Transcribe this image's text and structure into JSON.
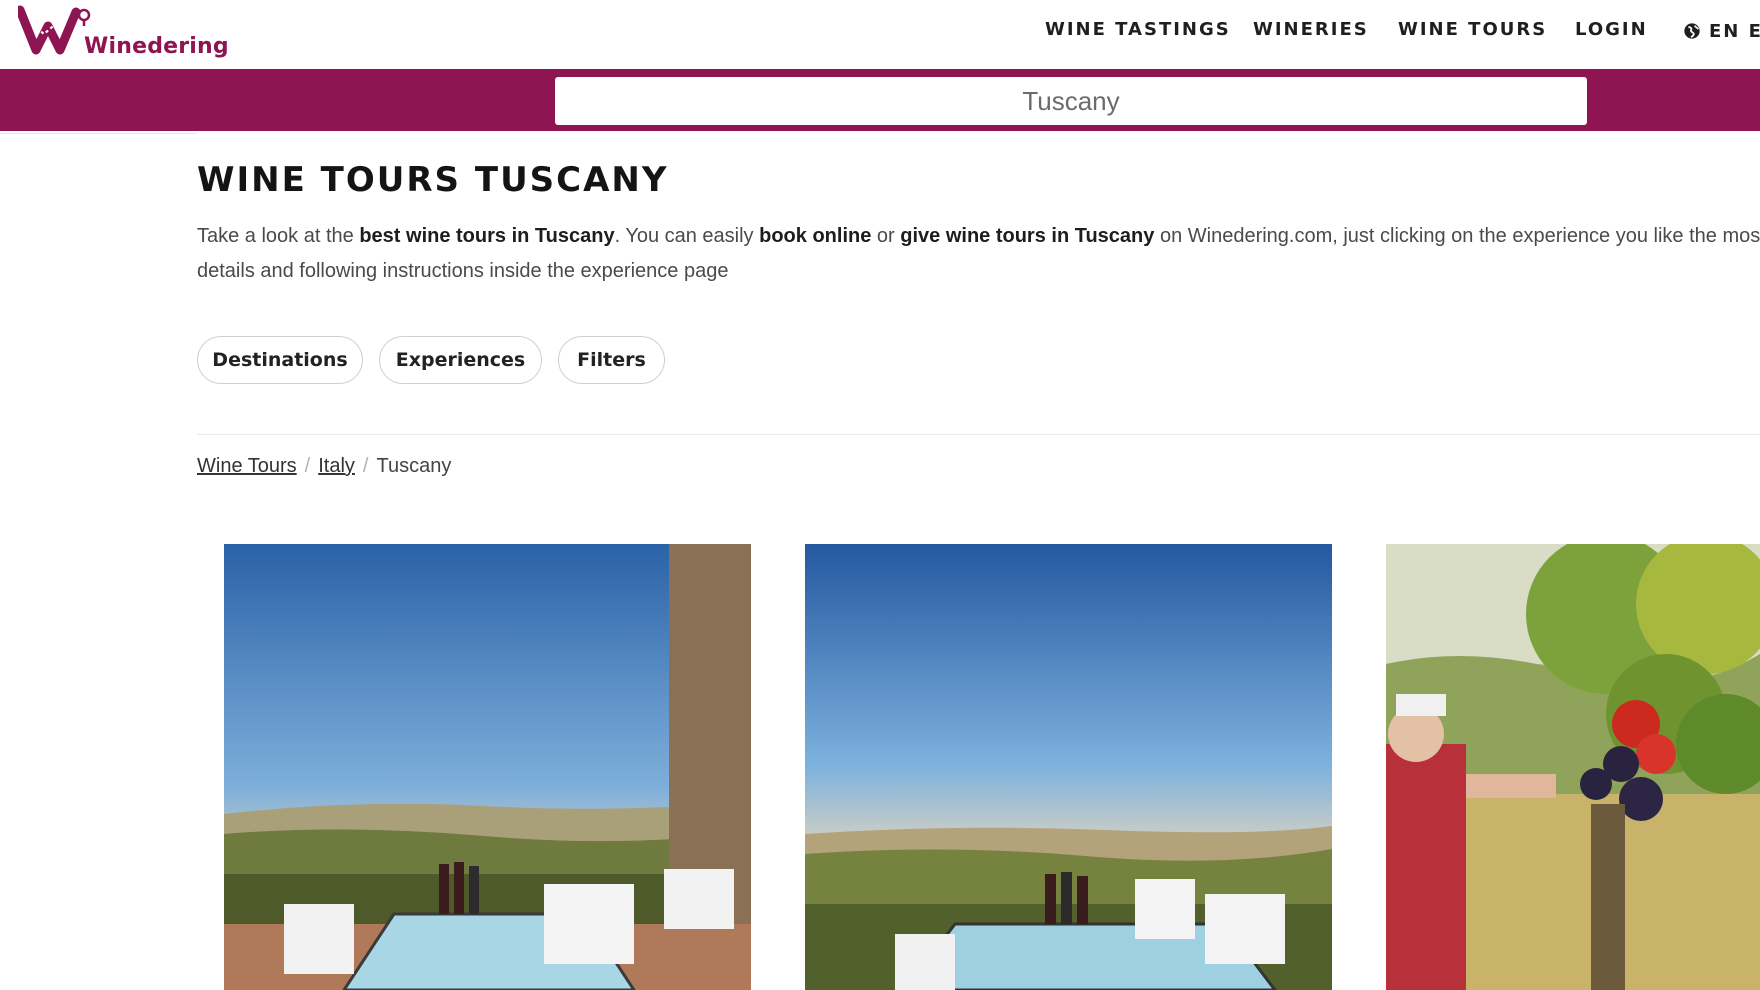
{
  "brand": {
    "logo_text": "Winedering"
  },
  "nav": {
    "items": [
      "WINE TASTINGS",
      "WINERIES",
      "WINE TOURS",
      "LOGIN"
    ],
    "lang": "EN EU"
  },
  "search": {
    "value": "Tuscany"
  },
  "page": {
    "title": "WINE TOURS TUSCANY",
    "intro": {
      "p1": "Take a look at the ",
      "b1": "best wine tours in Tuscany",
      "p2": ". You can easily ",
      "b2": "book online",
      "p3": " or ",
      "b3": "give wine tours in Tuscany",
      "p4": " on Winedering.com, just clicking on the experience you like the mos",
      "p5": "details and following instructions inside the experience page"
    }
  },
  "filters": [
    "Destinations",
    "Experiences",
    "Filters"
  ],
  "breadcrumb": {
    "items": [
      "Wine Tours",
      "Italy",
      "Tuscany"
    ],
    "separator": "/"
  },
  "colors": {
    "brand": "#8e1452",
    "text_dark": "#141414"
  },
  "icons": {
    "globe": "globe-icon"
  },
  "cards": [
    {
      "image": "terrace-table-vineyard-view"
    },
    {
      "image": "outdoor-table-wine-bottles-hills"
    },
    {
      "image": "grape-harvest-vineyard"
    }
  ]
}
